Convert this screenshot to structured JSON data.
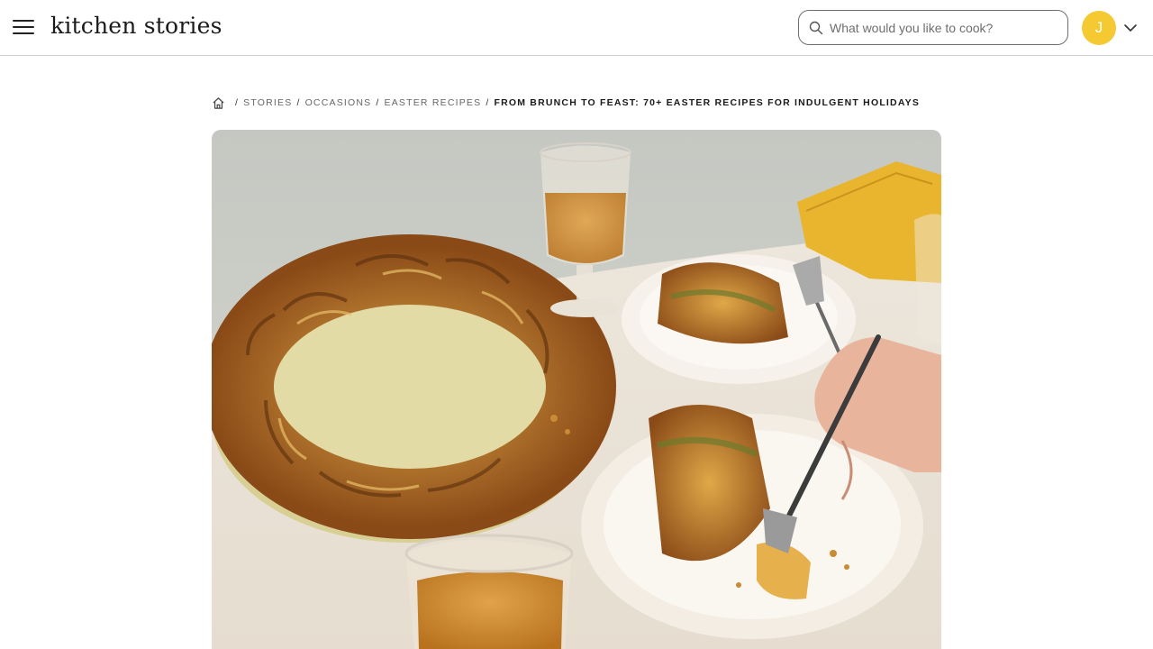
{
  "header": {
    "logo": "kitchen stories",
    "search": {
      "placeholder": "What would you like to cook?",
      "value": ""
    },
    "avatar_initial": "J",
    "icons": {
      "menu": "hamburger-menu-icon",
      "search": "search-icon",
      "account_menu": "chevron-down-icon"
    },
    "colors": {
      "avatar": "#f4c932",
      "border": "#cfcfcf"
    }
  },
  "breadcrumb": {
    "home_icon": "home-icon",
    "items": [
      "STORIES",
      "OCCASIONS",
      "EASTER RECIPES"
    ],
    "current": "FROM BRUNCH TO FEAST: 70+ EASTER RECIPES FOR INDULGENT HOLIDAYS"
  },
  "hero": {
    "description": "Braided pesto bread wreath on a plate with glasses of tea and slices on small plates"
  }
}
